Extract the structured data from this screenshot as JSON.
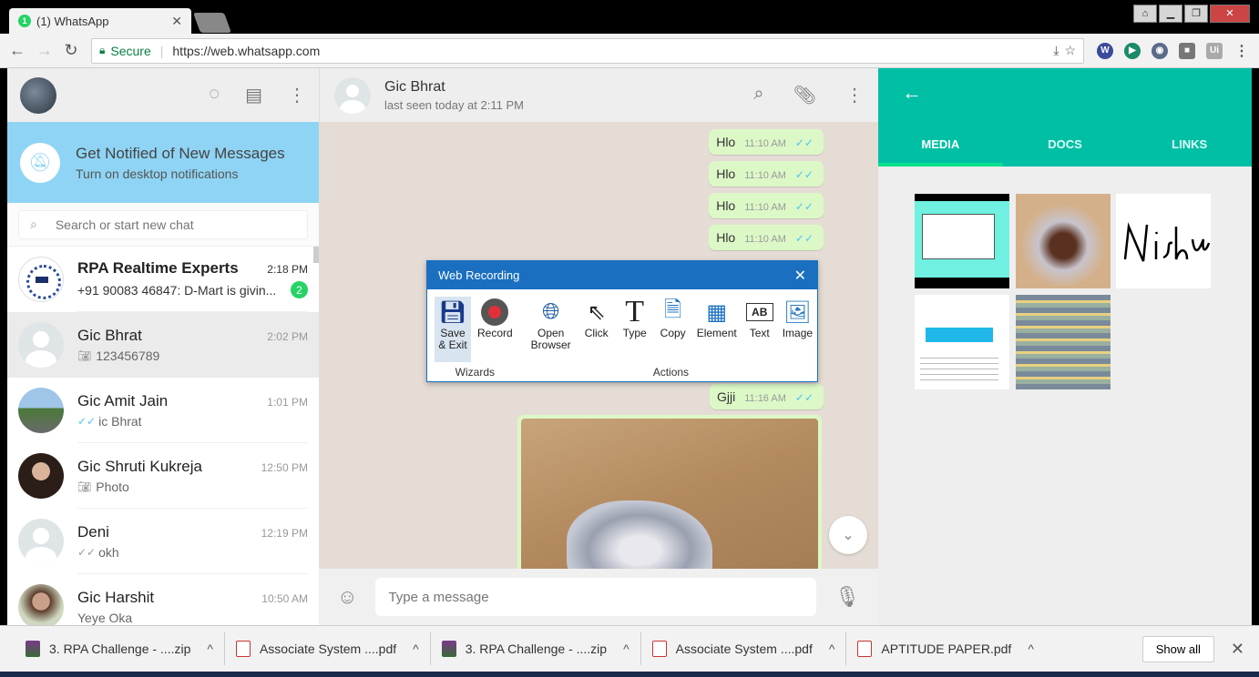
{
  "browser": {
    "tab_title": "(1) WhatsApp",
    "tab_badge": "1",
    "secure_label": "Secure",
    "url": "https://web.whatsapp.com"
  },
  "sidebar": {
    "notification": {
      "title": "Get Notified of New Messages",
      "subtitle": "Turn on desktop notifications"
    },
    "search_placeholder": "Search or start new chat",
    "chats": [
      {
        "name": "RPA Realtime Experts",
        "time": "2:18 PM",
        "last": "+91 90083 46847: D-Mart is givin...",
        "unread": "2"
      },
      {
        "name": "Gic Bhrat",
        "time": "2:02 PM",
        "last": "123456789"
      },
      {
        "name": "Gic Amit Jain",
        "time": "1:01 PM",
        "last": "ic Bhrat"
      },
      {
        "name": "Gic Shruti Kukreja",
        "time": "12:50 PM",
        "last": "Photo"
      },
      {
        "name": "Deni",
        "time": "12:19 PM",
        "last": "okh"
      },
      {
        "name": "Gic Harshit",
        "time": "10:50 AM",
        "last": "Yeye Oka"
      }
    ]
  },
  "conversation": {
    "contact_name": "Gic Bhrat",
    "contact_status": "last seen today at 2:11 PM",
    "messages": [
      {
        "text": "Hlo",
        "time": "11:10 AM"
      },
      {
        "text": "Hlo",
        "time": "11:10 AM"
      },
      {
        "text": "Hlo",
        "time": "11:10 AM"
      },
      {
        "text": "Hlo",
        "time": "11:10 AM"
      },
      {
        "text": "Gjji",
        "time": "11:16 AM"
      }
    ],
    "composer_placeholder": "Type a message"
  },
  "media_panel": {
    "tabs": [
      "MEDIA",
      "DOCS",
      "LINKS"
    ],
    "active_tab": "MEDIA",
    "accent": "#00bfa5"
  },
  "recorder": {
    "title": "Web Recording",
    "wizard_group": "Wizards",
    "actions_group": "Actions",
    "wizard_items": [
      "Save & Exit",
      "Record"
    ],
    "action_items": [
      "Open Browser",
      "Click",
      "Type",
      "Copy",
      "Element",
      "Text",
      "Image"
    ]
  },
  "downloads": {
    "items": [
      {
        "name": "3. RPA Challenge - ....zip",
        "kind": "zip"
      },
      {
        "name": "Associate System ....pdf",
        "kind": "pdf"
      },
      {
        "name": "3. RPA Challenge - ....zip",
        "kind": "zip"
      },
      {
        "name": "Associate System ....pdf",
        "kind": "pdf"
      },
      {
        "name": "APTITUDE PAPER.pdf",
        "kind": "pdf"
      }
    ],
    "show_all": "Show all"
  }
}
